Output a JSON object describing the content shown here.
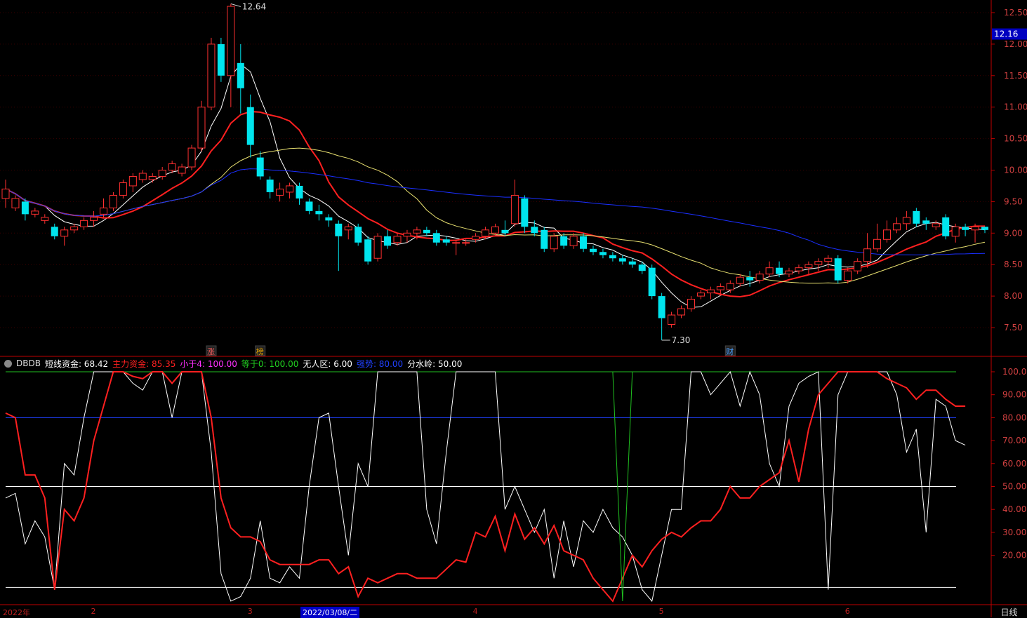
{
  "colors": {
    "up": "#ff3030",
    "down": "#00e5ee",
    "ma5": "#ffffff",
    "ma10": "#ff2020",
    "ma20": "#e8e070",
    "ma60": "#1a2fff",
    "axis": "#c00000",
    "price_label": "#d04040",
    "short_fund": "#ffffff",
    "main_fund": "#ff2020",
    "line_100": "#20c020",
    "line_80": "#2040ff",
    "line_50": "#ffffff",
    "line_6": "#ffffff"
  },
  "chart_data": [
    {
      "type": "candlestick",
      "price_axis": {
        "ticks": [
          "12.50",
          "12.00",
          "11.50",
          "11.00",
          "10.50",
          "10.00",
          "9.50",
          "9.00",
          "8.50",
          "8.00",
          "7.50"
        ]
      },
      "current_price": "12.16",
      "annotations": {
        "high": "12.64",
        "low": "7.30"
      },
      "markers": [
        {
          "label": "涨",
          "day": 21
        },
        {
          "label": "榜",
          "day": 26
        },
        {
          "label": "财",
          "day": 74
        }
      ],
      "candles": [
        [
          9.55,
          9.7,
          9.4,
          9.85
        ],
        [
          9.4,
          9.55,
          9.35,
          9.6
        ],
        [
          9.5,
          9.3,
          9.2,
          9.55
        ],
        [
          9.3,
          9.35,
          9.25,
          9.4
        ],
        [
          9.2,
          9.25,
          9.15,
          9.3
        ],
        [
          9.1,
          8.95,
          8.9,
          9.15
        ],
        [
          8.95,
          9.05,
          8.8,
          9.1
        ],
        [
          9.05,
          9.1,
          9.0,
          9.15
        ],
        [
          9.1,
          9.2,
          9.05,
          9.25
        ],
        [
          9.2,
          9.25,
          9.1,
          9.35
        ],
        [
          9.3,
          9.4,
          9.25,
          9.55
        ],
        [
          9.4,
          9.6,
          9.35,
          9.65
        ],
        [
          9.6,
          9.8,
          9.55,
          9.85
        ],
        [
          9.75,
          9.9,
          9.65,
          9.95
        ],
        [
          9.85,
          9.95,
          9.8,
          10.0
        ],
        [
          9.85,
          9.9,
          9.8,
          9.95
        ],
        [
          9.9,
          10.0,
          9.85,
          10.05
        ],
        [
          10.0,
          10.1,
          9.95,
          10.15
        ],
        [
          9.95,
          10.05,
          9.9,
          10.1
        ],
        [
          10.05,
          10.35,
          10.0,
          10.4
        ],
        [
          10.35,
          11.0,
          10.3,
          11.1
        ],
        [
          11.0,
          12.0,
          10.95,
          12.1
        ],
        [
          12.0,
          11.5,
          11.4,
          12.1
        ],
        [
          11.5,
          12.6,
          11.0,
          12.64
        ],
        [
          11.7,
          11.3,
          10.9,
          12.0
        ],
        [
          11.0,
          10.4,
          10.2,
          11.2
        ],
        [
          10.2,
          9.9,
          9.85,
          10.3
        ],
        [
          9.85,
          9.65,
          9.55,
          9.9
        ],
        [
          9.6,
          9.7,
          9.5,
          9.8
        ],
        [
          9.65,
          9.75,
          9.55,
          9.8
        ],
        [
          9.75,
          9.55,
          9.45,
          9.8
        ],
        [
          9.5,
          9.35,
          9.3,
          9.55
        ],
        [
          9.35,
          9.3,
          9.2,
          9.45
        ],
        [
          9.25,
          9.2,
          9.1,
          9.3
        ],
        [
          9.15,
          8.95,
          8.4,
          9.2
        ],
        [
          9.05,
          9.1,
          8.9,
          9.15
        ],
        [
          9.1,
          8.85,
          8.8,
          9.15
        ],
        [
          8.9,
          8.55,
          8.5,
          8.95
        ],
        [
          8.6,
          8.95,
          8.55,
          9.0
        ],
        [
          8.95,
          8.8,
          8.75,
          9.05
        ],
        [
          8.85,
          8.95,
          8.8,
          9.0
        ],
        [
          8.95,
          9.0,
          8.85,
          9.05
        ],
        [
          9.0,
          9.05,
          8.9,
          9.1
        ],
        [
          9.05,
          9.0,
          8.95,
          9.1
        ],
        [
          9.0,
          8.85,
          8.8,
          9.05
        ],
        [
          8.9,
          8.85,
          8.8,
          8.95
        ],
        [
          8.85,
          8.85,
          8.65,
          8.9
        ],
        [
          8.85,
          8.85,
          8.8,
          8.9
        ],
        [
          8.9,
          8.95,
          8.85,
          9.0
        ],
        [
          8.95,
          9.05,
          8.9,
          9.1
        ],
        [
          9.0,
          9.1,
          8.95,
          9.15
        ],
        [
          9.05,
          9.0,
          8.95,
          9.2
        ],
        [
          9.15,
          9.6,
          9.1,
          9.85
        ],
        [
          9.55,
          9.1,
          9.0,
          9.6
        ],
        [
          9.1,
          9.0,
          8.95,
          9.2
        ],
        [
          9.05,
          8.75,
          8.7,
          9.1
        ],
        [
          8.75,
          8.95,
          8.7,
          9.0
        ],
        [
          8.95,
          8.8,
          8.75,
          9.0
        ],
        [
          8.8,
          8.95,
          8.75,
          9.0
        ],
        [
          8.95,
          8.75,
          8.7,
          9.0
        ],
        [
          8.75,
          8.7,
          8.65,
          8.8
        ],
        [
          8.7,
          8.65,
          8.6,
          8.75
        ],
        [
          8.65,
          8.6,
          8.55,
          8.7
        ],
        [
          8.6,
          8.55,
          8.5,
          8.65
        ],
        [
          8.55,
          8.5,
          8.45,
          8.6
        ],
        [
          8.5,
          8.4,
          8.35,
          8.55
        ],
        [
          8.45,
          8.0,
          7.95,
          8.5
        ],
        [
          8.0,
          7.65,
          7.3,
          8.05
        ],
        [
          7.55,
          7.7,
          7.5,
          7.75
        ],
        [
          7.7,
          7.8,
          7.65,
          7.85
        ],
        [
          7.8,
          7.95,
          7.75,
          8.0
        ],
        [
          8.0,
          8.05,
          7.95,
          8.1
        ],
        [
          8.05,
          8.1,
          7.95,
          8.15
        ],
        [
          8.1,
          8.15,
          8.0,
          8.2
        ],
        [
          8.1,
          8.2,
          8.05,
          8.25
        ],
        [
          8.2,
          8.3,
          8.15,
          8.35
        ],
        [
          8.3,
          8.25,
          8.15,
          8.4
        ],
        [
          8.25,
          8.35,
          8.2,
          8.4
        ],
        [
          8.35,
          8.45,
          8.3,
          8.55
        ],
        [
          8.45,
          8.35,
          8.3,
          8.55
        ],
        [
          8.35,
          8.4,
          8.3,
          8.45
        ],
        [
          8.4,
          8.45,
          8.35,
          8.5
        ],
        [
          8.45,
          8.5,
          8.35,
          8.55
        ],
        [
          8.5,
          8.55,
          8.4,
          8.6
        ],
        [
          8.55,
          8.6,
          8.45,
          8.65
        ],
        [
          8.6,
          8.25,
          8.2,
          8.65
        ],
        [
          8.25,
          8.4,
          8.2,
          8.45
        ],
        [
          8.4,
          8.55,
          8.35,
          8.6
        ],
        [
          8.55,
          8.75,
          8.45,
          9.0
        ],
        [
          8.75,
          8.9,
          8.7,
          9.15
        ],
        [
          8.9,
          9.05,
          8.85,
          9.2
        ],
        [
          9.05,
          9.15,
          9.0,
          9.25
        ],
        [
          9.15,
          9.25,
          9.05,
          9.35
        ],
        [
          9.35,
          9.15,
          9.1,
          9.4
        ],
        [
          9.2,
          9.15,
          9.05,
          9.25
        ],
        [
          9.1,
          9.15,
          9.05,
          9.2
        ],
        [
          9.25,
          8.95,
          8.9,
          9.3
        ],
        [
          8.95,
          9.1,
          8.85,
          9.15
        ],
        [
          9.1,
          9.05,
          8.95,
          9.15
        ],
        [
          9.05,
          9.1,
          8.85,
          9.15
        ],
        [
          9.1,
          9.05,
          9.0,
          9.1
        ]
      ],
      "ma_lines": [
        {
          "name": "MA5",
          "color_key": "ma5"
        },
        {
          "name": "MA10",
          "color_key": "ma10"
        },
        {
          "name": "MA20",
          "color_key": "ma20"
        },
        {
          "name": "MA60",
          "color_key": "ma60"
        }
      ]
    },
    {
      "type": "line",
      "indicator": "DBDB",
      "legend": {
        "name": "DBDB",
        "items": [
          {
            "label": "短线资金: 68.42",
            "color_key": "short_fund"
          },
          {
            "label": "主力资金: 85.35",
            "color_key": "main_fund"
          },
          {
            "label": "小于4: 100.00",
            "color": "#ff30ff"
          },
          {
            "label": "等于0: 100.00",
            "color": "#20d020"
          },
          {
            "label": "无人区: 6.00",
            "color": "#ffffff"
          },
          {
            "label": "强势: 80.00",
            "color": "#2040ff"
          },
          {
            "label": "分水岭: 50.00",
            "color": "#ffffff"
          }
        ]
      },
      "y_ticks": [
        "100.00",
        "90.00",
        "80.00",
        "70.00",
        "60.00",
        "50.00",
        "40.00",
        "30.00",
        "20.00"
      ],
      "ylim": [
        0,
        100
      ],
      "hlines": [
        {
          "value": 100,
          "color_key": "line_100"
        },
        {
          "value": 80,
          "color_key": "line_80"
        },
        {
          "value": 50,
          "color_key": "line_50"
        },
        {
          "value": 6,
          "color_key": "line_6"
        }
      ],
      "series": [
        {
          "name": "短线资金",
          "color_key": "short_fund",
          "values": [
            45,
            47,
            25,
            35,
            28,
            5,
            60,
            55,
            80,
            100,
            100,
            100,
            100,
            95,
            92,
            100,
            100,
            80,
            100,
            100,
            100,
            65,
            12,
            0,
            2,
            10,
            35,
            10,
            8,
            15,
            10,
            50,
            80,
            82,
            50,
            20,
            60,
            50,
            100,
            100,
            100,
            100,
            100,
            40,
            25,
            65,
            100,
            100,
            100,
            100,
            100,
            40,
            50,
            40,
            30,
            40,
            10,
            35,
            15,
            35,
            30,
            40,
            32,
            28,
            20,
            5,
            0,
            20,
            40,
            40,
            100,
            100,
            90,
            95,
            100,
            85,
            100,
            90,
            60,
            50,
            85,
            95,
            98,
            100,
            5,
            90,
            100,
            100,
            100,
            100,
            100,
            90,
            65,
            75,
            30,
            88,
            85,
            70,
            68
          ]
        },
        {
          "name": "主力资金",
          "color_key": "main_fund",
          "values": [
            82,
            80,
            55,
            55,
            45,
            5,
            40,
            35,
            45,
            70,
            85,
            100,
            100,
            98,
            97,
            100,
            100,
            95,
            100,
            100,
            100,
            80,
            45,
            32,
            28,
            28,
            26,
            18,
            16,
            16,
            16,
            16,
            18,
            18,
            12,
            15,
            2,
            10,
            8,
            10,
            12,
            12,
            10,
            10,
            10,
            14,
            18,
            17,
            30,
            28,
            37,
            22,
            38,
            27,
            32,
            25,
            33,
            22,
            20,
            18,
            10,
            5,
            0,
            10,
            20,
            15,
            22,
            27,
            30,
            28,
            32,
            35,
            35,
            40,
            50,
            45,
            45,
            50,
            53,
            56,
            70,
            52,
            75,
            90,
            95,
            100,
            100,
            100,
            100,
            100,
            97,
            95,
            93,
            88,
            92,
            92,
            88,
            85,
            85
          ]
        }
      ]
    }
  ],
  "time_axis": {
    "labels": [
      {
        "text": "2022年",
        "day": 0
      },
      {
        "text": "2",
        "day": 9
      },
      {
        "text": "3",
        "day": 25
      },
      {
        "text": "4",
        "day": 48
      },
      {
        "text": "5",
        "day": 67
      },
      {
        "text": "6",
        "day": 86
      }
    ],
    "cursor_date": "2022/03/08/二",
    "period": "日线"
  }
}
